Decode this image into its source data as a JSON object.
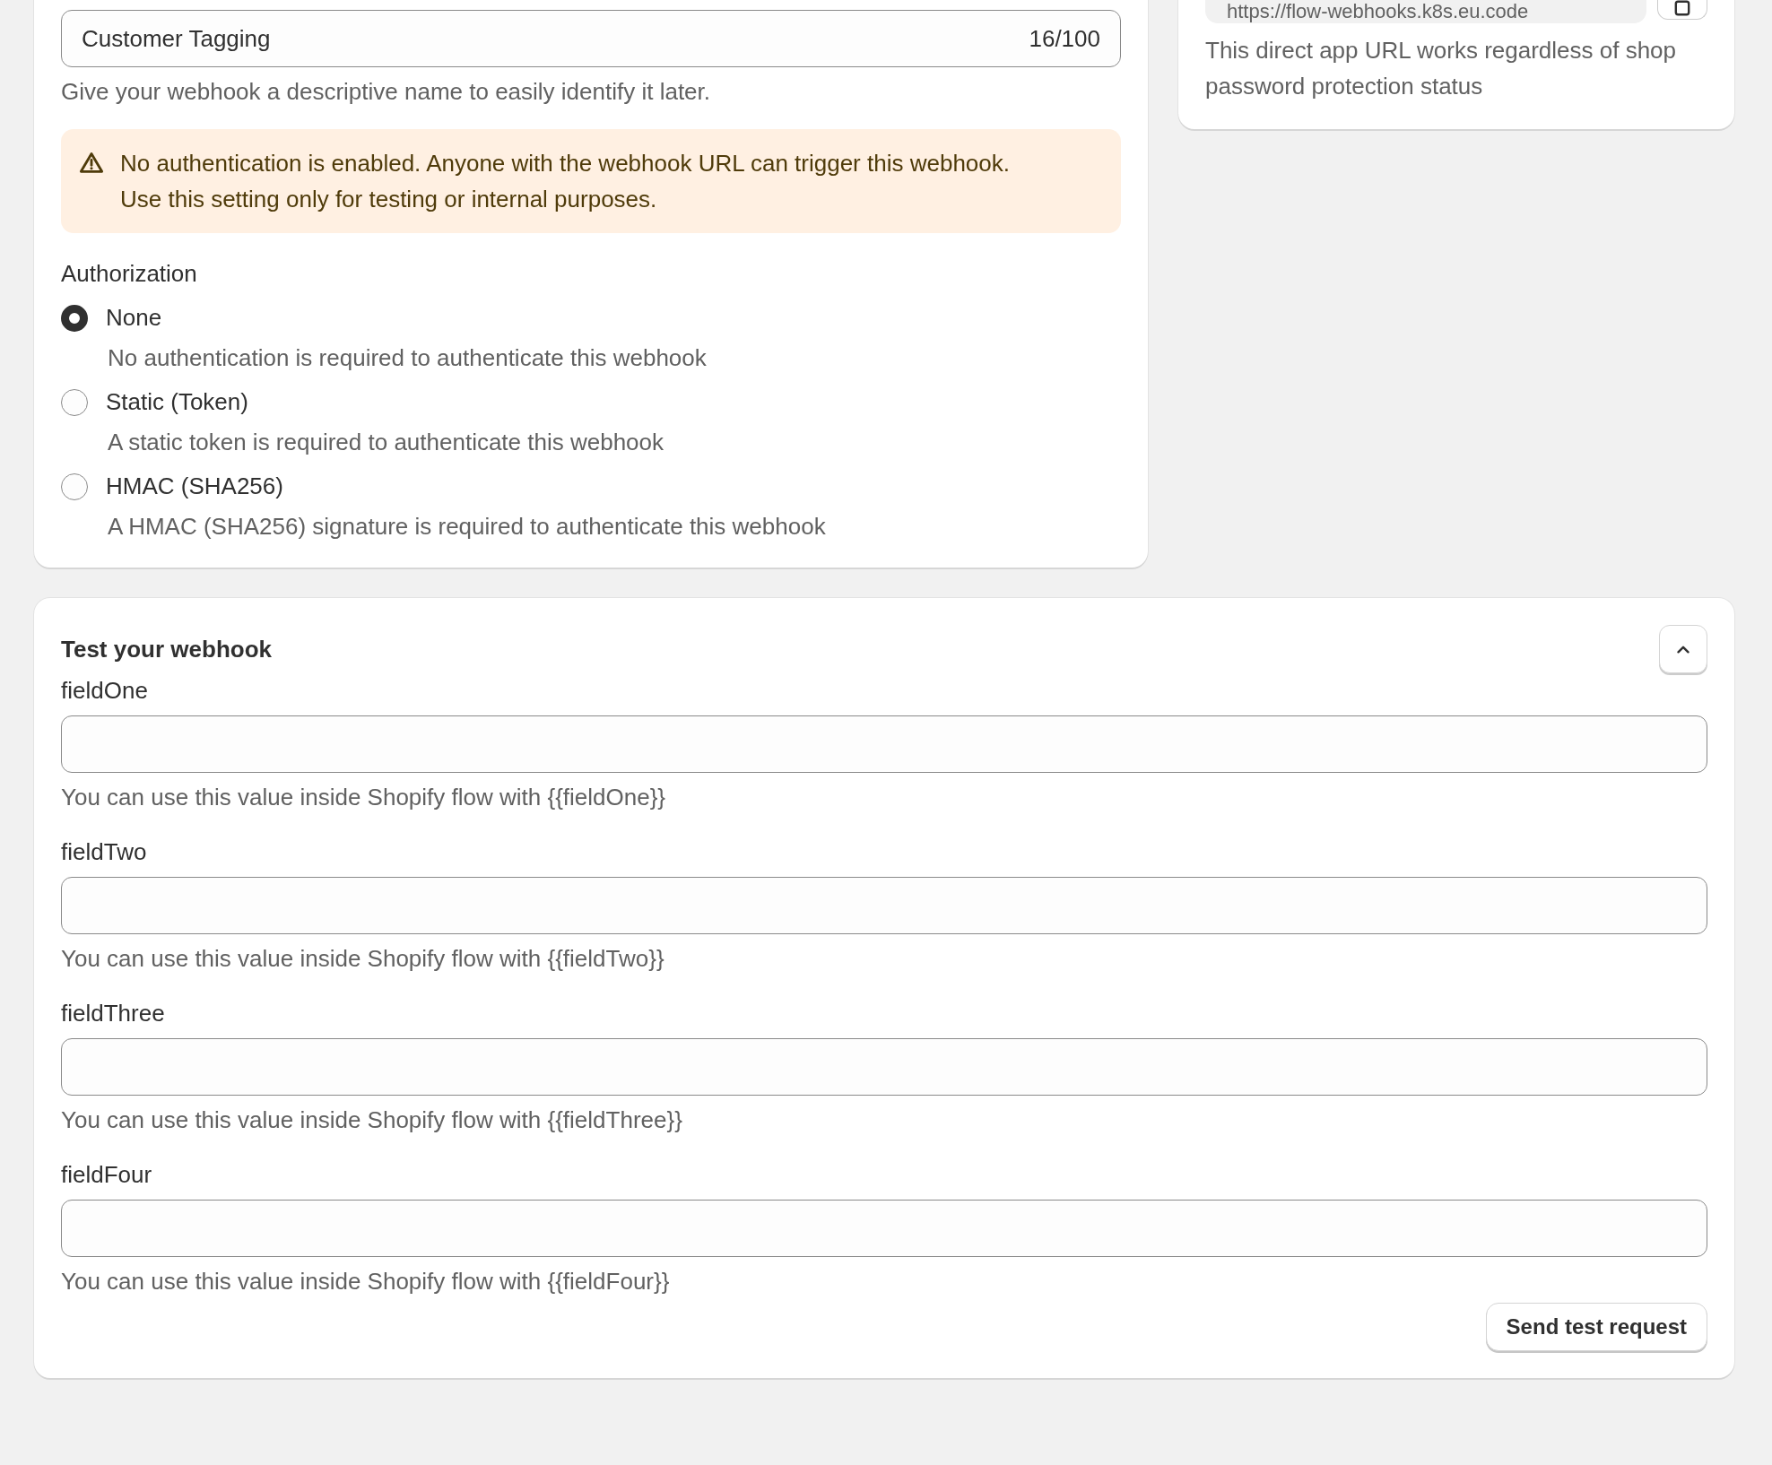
{
  "name_field": {
    "value": "Customer Tagging",
    "counter": "16/100",
    "help": "Give your webhook a descriptive name to easily identify it later."
  },
  "warning": {
    "lines": [
      "No authentication is enabled. Anyone with the webhook URL can trigger this webhook.",
      "Use this setting only for testing or internal purposes."
    ]
  },
  "authorization": {
    "label": "Authorization",
    "options": [
      {
        "label": "None",
        "description": "No authentication is required to authenticate this webhook",
        "selected": true
      },
      {
        "label": "Static (Token)",
        "description": "A static token is required to authenticate this webhook",
        "selected": false
      },
      {
        "label": "HMAC (SHA256)",
        "description": "A HMAC (SHA256) signature is required to authenticate this webhook",
        "selected": false
      }
    ]
  },
  "url_card": {
    "url": "https://flow-webhooks.k8s.eu.code",
    "note": "This direct app URL works regardless of shop password protection status"
  },
  "test_card": {
    "title": "Test your webhook",
    "expanded": true,
    "fields": [
      {
        "label": "fieldOne",
        "hint": "You can use this value inside Shopify flow with {{fieldOne}}"
      },
      {
        "label": "fieldTwo",
        "hint": "You can use this value inside Shopify flow with {{fieldTwo}}"
      },
      {
        "label": "fieldThree",
        "hint": "You can use this value inside Shopify flow with {{fieldThree}}"
      },
      {
        "label": "fieldFour",
        "hint": "You can use this value inside Shopify flow with {{fieldFour}}"
      }
    ],
    "button": "Send test request"
  }
}
